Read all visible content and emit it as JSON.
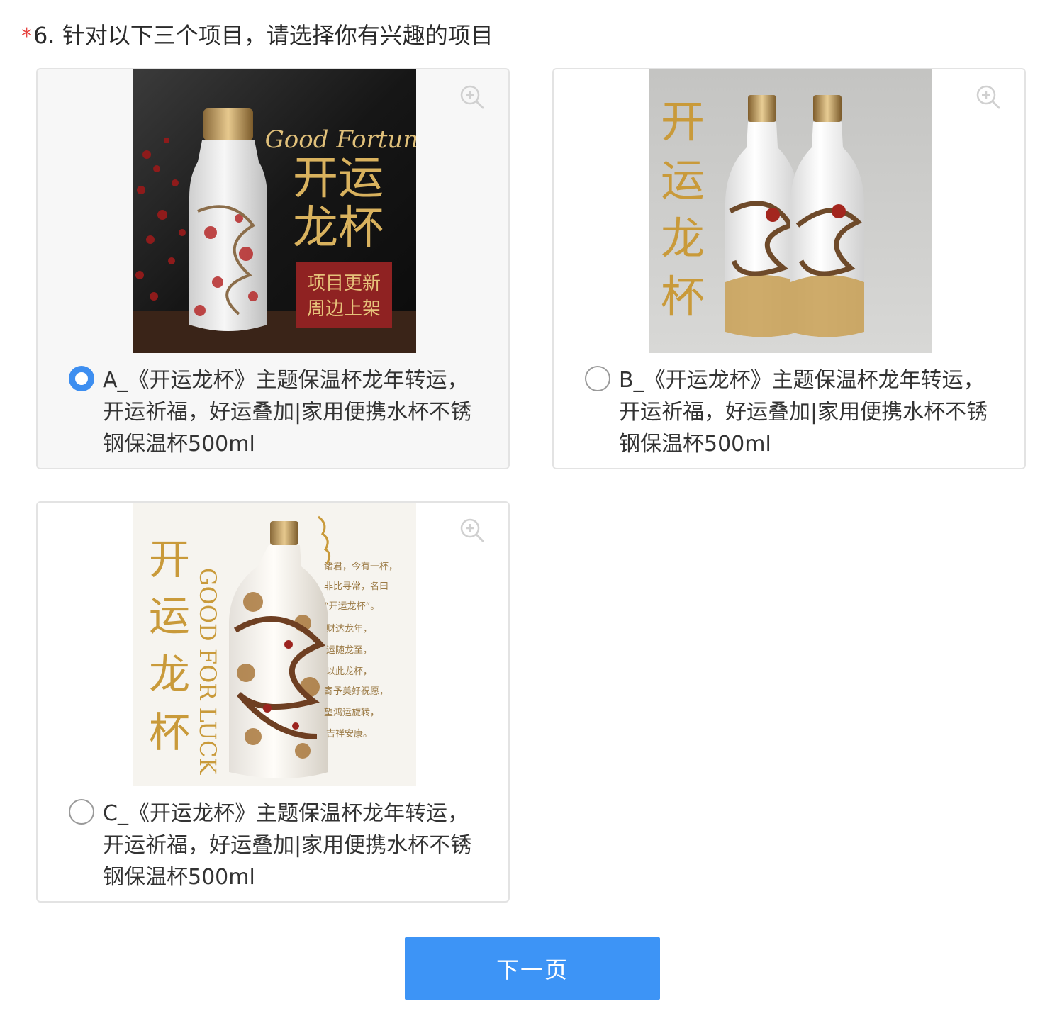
{
  "question": {
    "required_mark": "*",
    "title": "6. 针对以下三个项目，请选择你有兴趣的项目"
  },
  "options": [
    {
      "label": "A_《开运龙杯》主题保温杯龙年转运，开运祈福，好运叠加|家用便携水杯不锈钢保温杯500ml",
      "selected": true,
      "image_text": {
        "brand": "Good Fortune",
        "title_line1": "开运",
        "title_line2": "龙杯",
        "badge_line1": "项目更新",
        "badge_line2": "周边上架"
      }
    },
    {
      "label": "B_《开运龙杯》主题保温杯龙年转运，开运祈福，好运叠加|家用便携水杯不锈钢保温杯500ml",
      "selected": false,
      "image_text": {
        "vertical_title": [
          "开",
          "运",
          "龙",
          "杯"
        ]
      }
    },
    {
      "label": "C_《开运龙杯》主题保温杯龙年转运，开运祈福，好运叠加|家用便携水杯不锈钢保温杯500ml",
      "selected": false,
      "image_text": {
        "vertical_title": [
          "开",
          "运",
          "龙",
          "杯"
        ],
        "vertical_english": "GOOD FOR LUCK",
        "poem": [
          "诸君，今有一杯，",
          "非比寻常，名曰",
          "“开运龙杯”。",
          "财达龙年，",
          "运随龙至，",
          "以此龙杯，",
          "寄予美好祝愿，",
          "望鸿运旋转，",
          "吉祥安康。"
        ]
      }
    }
  ],
  "next_button": {
    "label": "下一页"
  },
  "colors": {
    "accent": "#3d94f6",
    "radio_checked": "#3d8ef0",
    "required": "#e64340",
    "gold": "#c9a04a"
  }
}
